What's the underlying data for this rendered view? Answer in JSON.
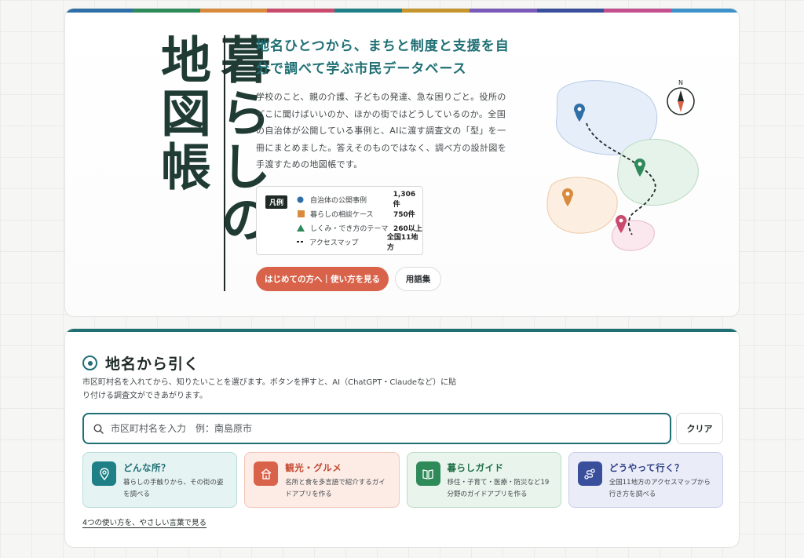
{
  "hero": {
    "title": "暮らしの地図帳",
    "lead": "地名ひとつから、まちと制度と支援を自分で調べて学ぶ市民データベース",
    "description": "学校のこと、親の介護、子どもの発達、急な困りごと。役所のどこに聞けばいいのか、ほかの街ではどうしているのか。全国の自治体が公開している事例と、AIに渡す調査文の「型」を一冊にまとめました。答えそのものではなく、調べ方の設計図を手渡すための地図帳です。",
    "stripe_colors": [
      "#2f6fa8",
      "#2f8a5a",
      "#d98a3c",
      "#c94b6e",
      "#1f7f86",
      "#c6962e",
      "#7a5ab8",
      "#3a4f9c",
      "#c24f8e",
      "#3d93c9"
    ],
    "legend": {
      "tag": "凡例",
      "rows": [
        {
          "symbol": "circle-blue",
          "label": "自治体の公開事例",
          "value": "1,306件"
        },
        {
          "symbol": "square-orange",
          "label": "暮らしの相談ケース",
          "value": "750件"
        },
        {
          "symbol": "triangle-green",
          "label": "しくみ・でき方のテーマ",
          "value": "260以上"
        },
        {
          "symbol": "dashes",
          "label": "アクセスマップ",
          "value": "全国11地方"
        }
      ]
    },
    "primary_button": "はじめての方へ｜使い方を見る",
    "secondary_button": "用語集",
    "compass_label": "N"
  },
  "search": {
    "title": "地名から引く",
    "description": "市区町村名を入れてから、知りたいことを選びます。ボタンを押すと、AI（ChatGPT・Claudeなど）に貼り付ける調査文ができあがります。",
    "placeholder": "市区町村名を入力　例：南島原市",
    "clear_button": "クリア",
    "modes": [
      {
        "title": "どんな所？",
        "desc": "暮らしの手触りから、その街の姿を調べる",
        "icon": "map-pin-icon"
      },
      {
        "title": "観光・グルメ",
        "desc": "名所と食を多言語で紹介するガイドアプリを作る",
        "icon": "building-icon"
      },
      {
        "title": "暮らしガイド",
        "desc": "移住・子育て・医療・防災など19分野のガイドアプリを作る",
        "icon": "book-icon"
      },
      {
        "title": "どうやって行く？",
        "desc": "全国11地方のアクセスマップから行き方を調べる",
        "icon": "route-icon"
      }
    ],
    "more_link": "4つの使い方を、やさしい言葉で見る"
  },
  "colors": {
    "accent": "#1f6f74",
    "primary_button": "#d9634a"
  }
}
